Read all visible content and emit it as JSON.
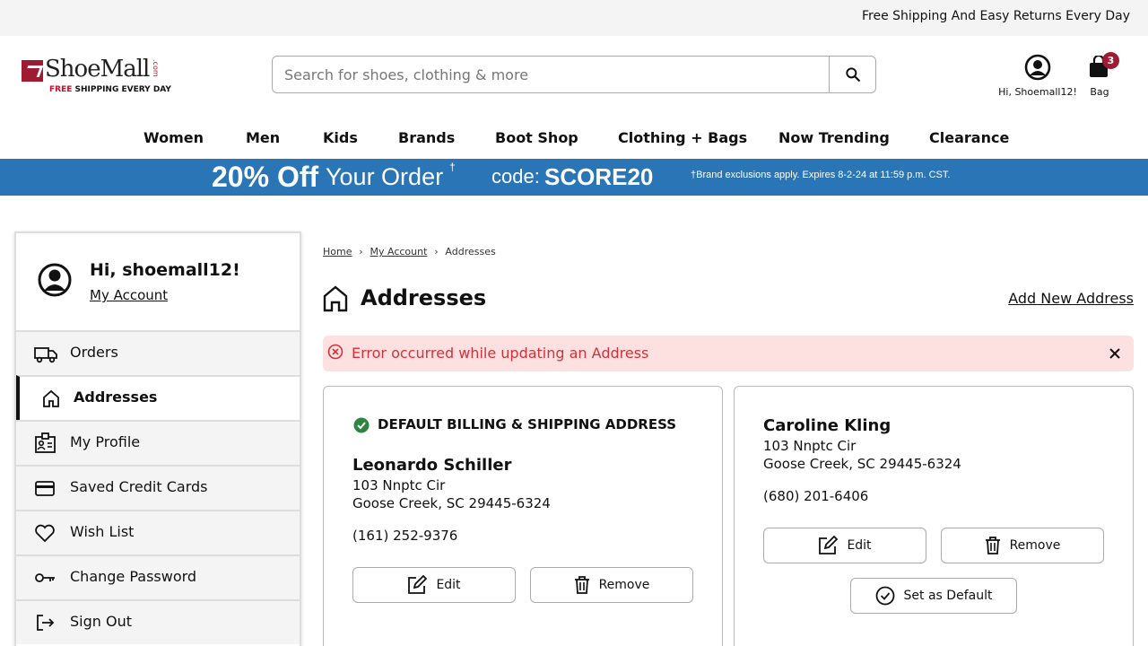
{
  "topbar": {
    "message": "Free Shipping And Easy Returns Every Day"
  },
  "logo": {
    "name": "ShoeMall",
    "dotcom": ".com",
    "tag_free": "FREE",
    "tag_rest": " SHIPPING EVERY DAY"
  },
  "search": {
    "placeholder": "Search for shoes, clothing & more",
    "button_icon": "search-icon"
  },
  "account": {
    "label": "Hi, Shoemall12!",
    "icon": "account-circle-icon"
  },
  "bag": {
    "label": "Bag",
    "count": "3",
    "icon": "shopping-bag-icon"
  },
  "nav": [
    "Women",
    "Men",
    "Kids",
    "Brands",
    "Boot Shop",
    "Clothing + Bags",
    "Now Trending",
    "Clearance"
  ],
  "promo": {
    "percent": "20% Off",
    "text": "Your Order",
    "dagger": "†",
    "code_label": "code:",
    "code": "SCORE20",
    "disclaimer": "†Brand exclusions apply. Expires 8-2-24 at 11:59 p.m. CST.",
    "color": "#2975b6"
  },
  "sidebar": {
    "greeting": "Hi, shoemall12!",
    "my_account": "My Account",
    "items": [
      {
        "label": "Orders",
        "icon": "truck-icon"
      },
      {
        "label": "Addresses",
        "icon": "home-icon",
        "active": true
      },
      {
        "label": "My Profile",
        "icon": "id-card-icon"
      },
      {
        "label": "Saved Credit Cards",
        "icon": "credit-card-icon"
      },
      {
        "label": "Wish List",
        "icon": "heart-icon"
      },
      {
        "label": "Change Password",
        "icon": "key-icon"
      },
      {
        "label": "Sign Out",
        "icon": "sign-out-icon"
      }
    ]
  },
  "breadcrumb": [
    "Home",
    "My Account",
    "Addresses"
  ],
  "page": {
    "title": "Addresses",
    "add_new": "Add New Address"
  },
  "alert": {
    "message": "Error occurred while updating an Address",
    "color": "#d3323b"
  },
  "addresses": [
    {
      "default_label": "DEFAULT BILLING & SHIPPING ADDRESS",
      "name": "Leonardo Schiller",
      "street": "103 Nnptc Cir",
      "city": "Goose Creek, SC 29445-6324",
      "phone": "(161) 252-9376",
      "edit": "Edit",
      "remove": "Remove"
    },
    {
      "name": "Caroline Kling",
      "street": "103 Nnptc Cir",
      "city": "Goose Creek, SC 29445-6324",
      "phone": "(680) 201-6406",
      "edit": "Edit",
      "remove": "Remove",
      "set_default": "Set as Default"
    }
  ]
}
